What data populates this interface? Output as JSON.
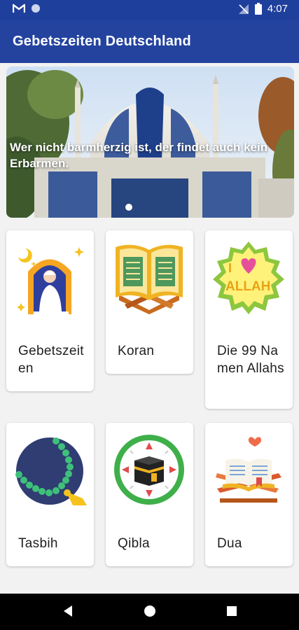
{
  "status_bar": {
    "time": "4:07",
    "icons": [
      "gmail-icon",
      "circle-notification-icon",
      "signal-off-icon",
      "battery-icon"
    ]
  },
  "app_bar": {
    "title": "Gebetszeiten Deutschland"
  },
  "banner": {
    "quote": "Wer nicht barmherzig ist, der findet auch kein Erbarmen.",
    "page_indicator": 1
  },
  "menu": {
    "items": [
      {
        "label": "Gebetszeiten",
        "icon": "praying-person-icon"
      },
      {
        "label": "Koran",
        "icon": "open-quran-icon"
      },
      {
        "label": "Die 99 Namen Allahs",
        "icon": "i-love-allah-icon"
      },
      {
        "label": "Tasbih",
        "icon": "prayer-beads-icon"
      },
      {
        "label": "Qibla",
        "icon": "kaaba-compass-icon"
      },
      {
        "label": "Dua",
        "icon": "book-on-stand-icon"
      }
    ]
  },
  "nav_bar": {
    "buttons": [
      "back-button",
      "home-button",
      "recents-button"
    ]
  },
  "colors": {
    "primary": "#23439f",
    "status": "#1f3f9c"
  }
}
